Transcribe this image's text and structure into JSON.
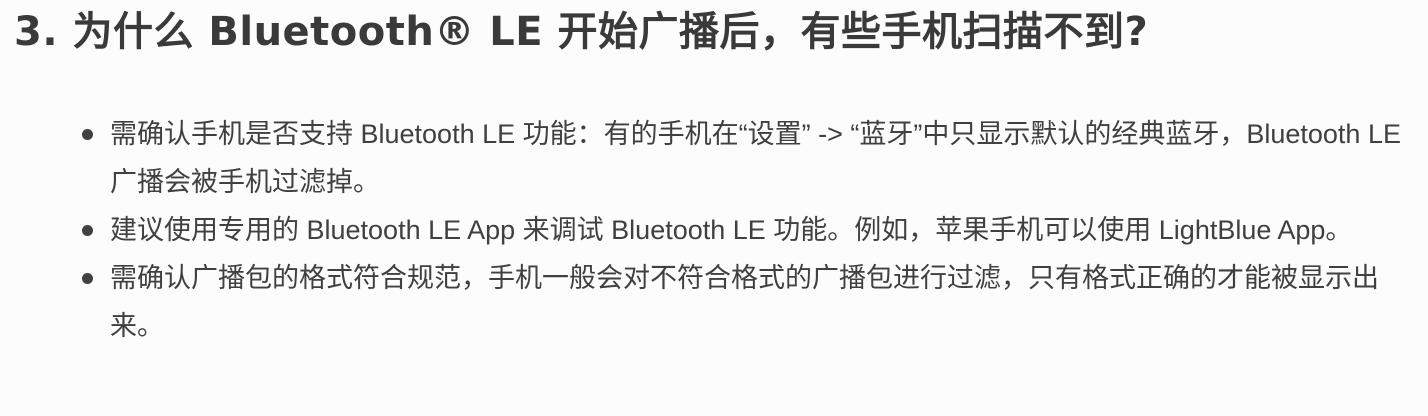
{
  "heading": "3. 为什么 Bluetooth® LE 开始广播后，有些手机扫描不到?",
  "bullets": [
    "需确认手机是否支持 Bluetooth LE 功能：有的手机在“设置” -> “蓝牙”中只显示默认的经典蓝牙，Bluetooth LE 广播会被手机过滤掉。",
    "建议使用专用的 Bluetooth LE App 来调试 Bluetooth LE 功能。例如，苹果手机可以使用 LightBlue App。",
    "需确认广播包的格式符合规范，手机一般会对不符合格式的广播包进行过滤，只有格式正确的才能被显示出来。"
  ]
}
